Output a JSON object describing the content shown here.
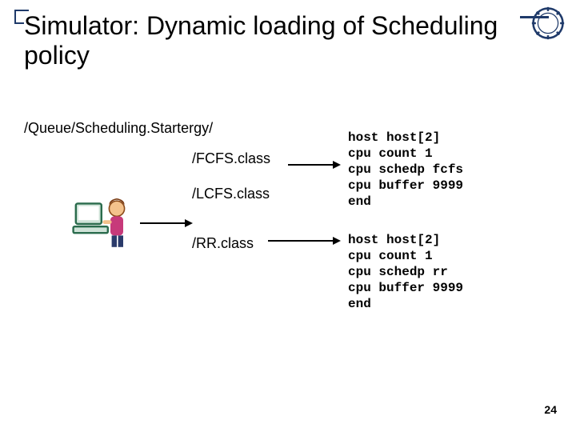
{
  "title": "Simulator: Dynamic loading of Scheduling policy",
  "path": "/Queue/Scheduling.Startergy/",
  "classes": {
    "fcfs": "/FCFS.class",
    "lcfs": "/LCFS.class",
    "rr": "/RR.class"
  },
  "code_block_1": "host host[2]\ncpu count 1\ncpu schedp fcfs\ncpu buffer 9999\nend",
  "code_block_2": "host host[2]\ncpu count 1\ncpu schedp rr\ncpu buffer 9999\nend",
  "page_number": "24"
}
